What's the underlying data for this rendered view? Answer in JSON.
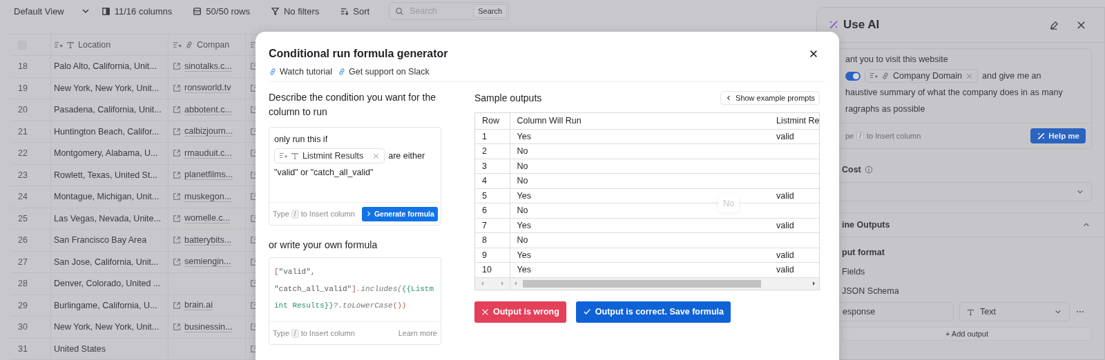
{
  "toolbar": {
    "view": "Default View",
    "columns": "11/16 columns",
    "rows": "50/50 rows",
    "filters": "No filters",
    "sort": "Sort",
    "search": {
      "placeholder": "Search",
      "button": "Search"
    }
  },
  "table": {
    "select_all": {
      "checked": false
    },
    "columns": [
      {
        "label": "Location",
        "kind": "text"
      },
      {
        "label": "Compan",
        "kind": "link"
      },
      {
        "kind": "link"
      }
    ],
    "rows": [
      {
        "row": "18",
        "location": "Palo Alto, California, Unit...",
        "company": "sinotalks.c..."
      },
      {
        "row": "19",
        "location": "New York, New York, Unit...",
        "company": "ronsworld.tv"
      },
      {
        "row": "20",
        "location": "Pasadena, California, Unit...",
        "company": "abbotent.c..."
      },
      {
        "row": "21",
        "location": "Huntington Beach, Califor...",
        "company": "calbizjourn..."
      },
      {
        "row": "22",
        "location": "Montgomery, Alabama, U...",
        "company": "rmauduit.c..."
      },
      {
        "row": "23",
        "location": "Rowlett, Texas, United St...",
        "company": "planetfilms..."
      },
      {
        "row": "24",
        "location": "Montague, Michigan, Unit...",
        "company": "muskegon..."
      },
      {
        "row": "25",
        "location": "Las Vegas, Nevada, Unite...",
        "company": "womelle.c..."
      },
      {
        "row": "26",
        "location": "San Francisco Bay Area",
        "company": "batterybits..."
      },
      {
        "row": "27",
        "location": "San Jose, California, Unit...",
        "company": "semiengin..."
      },
      {
        "row": "28",
        "location": "Denver, Colorado, United ..."
      },
      {
        "row": "29",
        "location": "Burlingame, California, U...",
        "company": "brain.ai"
      },
      {
        "row": "30",
        "location": "New York, New York, Unit...",
        "company": "businessin..."
      },
      {
        "row": "31",
        "location": "United States"
      }
    ]
  },
  "modal": {
    "title": "Conditional run formula generator",
    "links": [
      "Watch tutorial",
      "Get support on Slack"
    ],
    "condition": {
      "heading": "Describe the condition you want for the column to run",
      "text_before": "only run this if",
      "chip": "Listmint Results",
      "text_after": "are either",
      "text_line2": "\"valid\" or \"catch_all_valid\"",
      "hint": {
        "before": "Type",
        "key": "/",
        "after": "to Insert column"
      },
      "button": "Generate formula"
    },
    "formula": {
      "heading": "or write your own formula",
      "tokens": [
        {
          "text": "[",
          "kind": "punct"
        },
        {
          "text": "\"valid\", \"catch_all_valid\"",
          "kind": "string"
        },
        {
          "text": "]",
          "kind": "punct"
        },
        {
          "text": ".includes(",
          "kind": "method"
        },
        {
          "text": "{{Listmint Results}}",
          "kind": "variable"
        },
        {
          "text": "?.toLowerCase",
          "kind": "method"
        },
        {
          "text": "())",
          "kind": "punct"
        }
      ],
      "hint": {
        "before": "Type",
        "key": "/",
        "after": "to Insert column"
      },
      "link": "Learn more"
    },
    "samples": {
      "heading": "Sample outputs",
      "prompts_button": "Show example prompts",
      "columns": [
        "Row",
        "Column Will Run",
        "Listmint Re"
      ],
      "rows": [
        {
          "row": "1",
          "will_run": "Yes",
          "listmint": "valid"
        },
        {
          "row": "2",
          "will_run": "No"
        },
        {
          "row": "3",
          "will_run": "No"
        },
        {
          "row": "4",
          "will_run": "No"
        },
        {
          "row": "5",
          "will_run": "Yes",
          "listmint": "valid"
        },
        {
          "row": "6",
          "will_run": "No"
        },
        {
          "row": "7",
          "will_run": "Yes",
          "listmint": "valid"
        },
        {
          "row": "8",
          "will_run": "No"
        },
        {
          "row": "9",
          "will_run": "Yes",
          "listmint": "valid"
        },
        {
          "row": "10",
          "will_run": "Yes",
          "listmint": "valid"
        }
      ],
      "hover_label": "No"
    },
    "actions": [
      {
        "label": "Output is wrong",
        "kind": "reject"
      },
      {
        "label": "Output is correct. Save formula",
        "kind": "accept"
      }
    ]
  },
  "ai_panel": {
    "title": "Use AI",
    "prompt": {
      "line1": "ant you to visit this website",
      "toggle": {
        "on": true
      },
      "chip": "Company Domain",
      "after_chip": "and give me an",
      "line3": "haustive summary of what the company does in as many",
      "line4": "ragraphs as possible"
    },
    "hint": {
      "before": "pe",
      "key": "/",
      "after": "to Insert column"
    },
    "help_button": "Help me",
    "cost_label": "Cost",
    "outputs": {
      "title": "ine Outputs",
      "expanded": true,
      "format_label": "put format",
      "options": [
        {
          "label": "Fields"
        },
        {
          "label": "JSON Schema"
        }
      ],
      "field": {
        "value": "esponse",
        "type": "Text"
      },
      "add_button": "+ Add output"
    }
  }
}
